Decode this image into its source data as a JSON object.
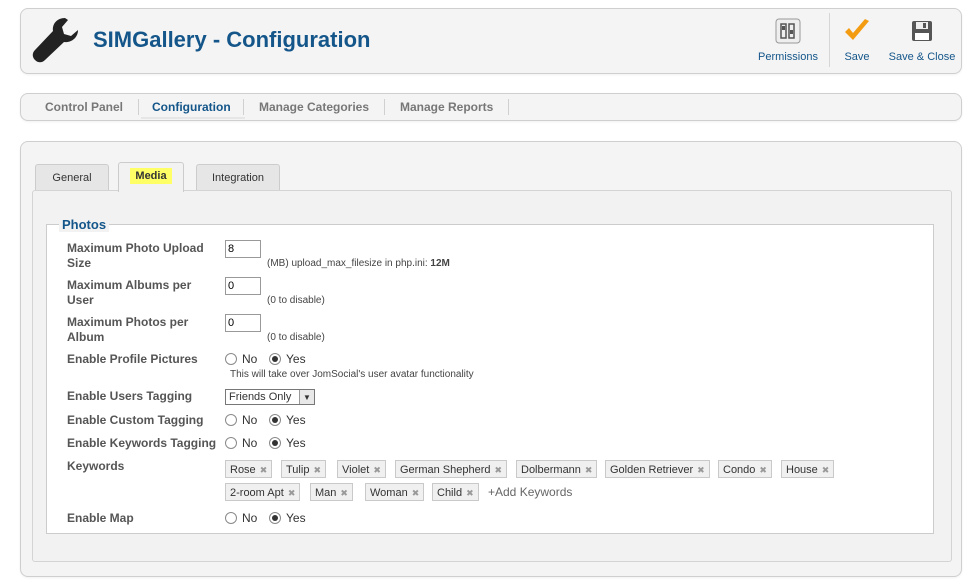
{
  "header": {
    "title": "SIMGallery - Configuration",
    "logo_icon": "wrench-icon",
    "toolbar": {
      "permissions_label": "Permissions",
      "save_label": "Save",
      "save_close_label": "Save & Close"
    }
  },
  "submenu": {
    "items": [
      "Control Panel",
      "Configuration",
      "Manage Categories",
      "Manage Reports"
    ],
    "active": "Configuration"
  },
  "tabs": {
    "items": [
      "General",
      "Media",
      "Integration"
    ],
    "active": "Media"
  },
  "photos": {
    "legend": "Photos",
    "max_upload": {
      "label_line1": "Maximum Photo Upload",
      "label_line2": "Size",
      "value": "8",
      "hint_prefix": "(MB) upload_max_filesize in php.ini:",
      "hint_value": "12M"
    },
    "max_albums": {
      "label_line1": "Maximum Albums per",
      "label_line2": "User",
      "value": "0",
      "hint": "(0 to disable)"
    },
    "max_photos": {
      "label_line1": "Maximum Photos per",
      "label_line2": "Album",
      "value": "0",
      "hint": "(0 to disable)"
    },
    "profile_pictures": {
      "label": "Enable Profile Pictures",
      "no": "No",
      "yes": "Yes",
      "selected": "Yes",
      "hint": "This will take over JomSocial's user avatar functionality"
    },
    "users_tagging": {
      "label": "Enable Users Tagging",
      "value": "Friends Only"
    },
    "custom_tagging": {
      "label": "Enable Custom Tagging",
      "no": "No",
      "yes": "Yes",
      "selected": "Yes"
    },
    "keywords_tagging": {
      "label": "Enable Keywords Tagging",
      "no": "No",
      "yes": "Yes",
      "selected": "Yes"
    },
    "keywords": {
      "label": "Keywords",
      "items": [
        "Rose",
        "Tulip",
        "Violet",
        "German Shepherd",
        "Dolbermann",
        "Golden Retriever",
        "Condo",
        "House",
        "2-room Apt",
        "Man",
        "Woman",
        "Child"
      ],
      "add_label": "+Add Keywords"
    },
    "map": {
      "label": "Enable Map",
      "no": "No",
      "yes": "Yes",
      "selected": "Yes"
    }
  },
  "colors": {
    "accent": "#14568a",
    "save_check": "#f39c12",
    "tab_highlight": "#ffff66"
  }
}
